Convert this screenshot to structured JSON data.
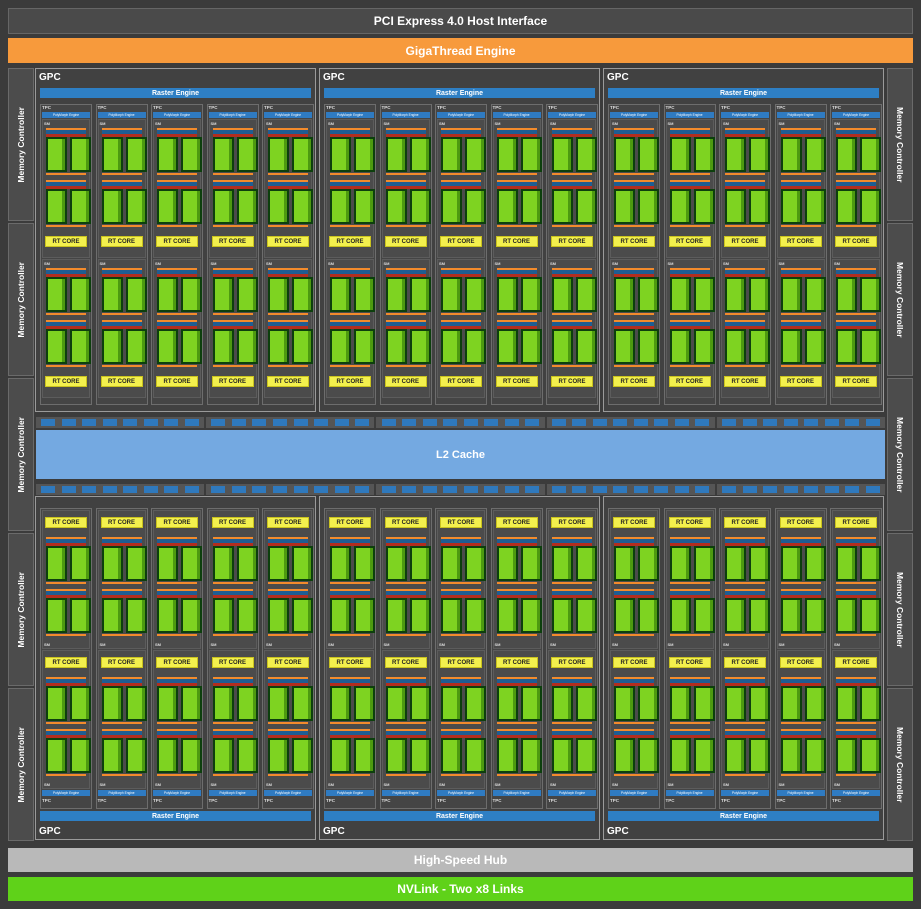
{
  "pci": "PCI Express 4.0 Host Interface",
  "giga": "GigaThread Engine",
  "l2": "L2 Cache",
  "hub": "High-Speed Hub",
  "nvlink": "NVLink - Two x8 Links",
  "memory_controller": "Memory Controller",
  "gpc_label": "GPC",
  "raster_engine": "Raster Engine",
  "tpc_label": "TPC",
  "polymorph_engine": "PolyMorph Engine",
  "sm_label": "SM",
  "rt_core": "RT CORE",
  "colors": {
    "accent_orange": "#f79a3c",
    "nvlink_green": "#5fd219",
    "l2_blue": "#74a9e1",
    "raster_blue": "#2e7fc4",
    "rt_yellow": "#f3f04d"
  },
  "counts": {
    "gpcs_per_row": 3,
    "gpc_rows": 2,
    "tpcs_per_gpc": 5,
    "sms_per_tpc": 2,
    "memory_controllers_per_side": 5
  }
}
